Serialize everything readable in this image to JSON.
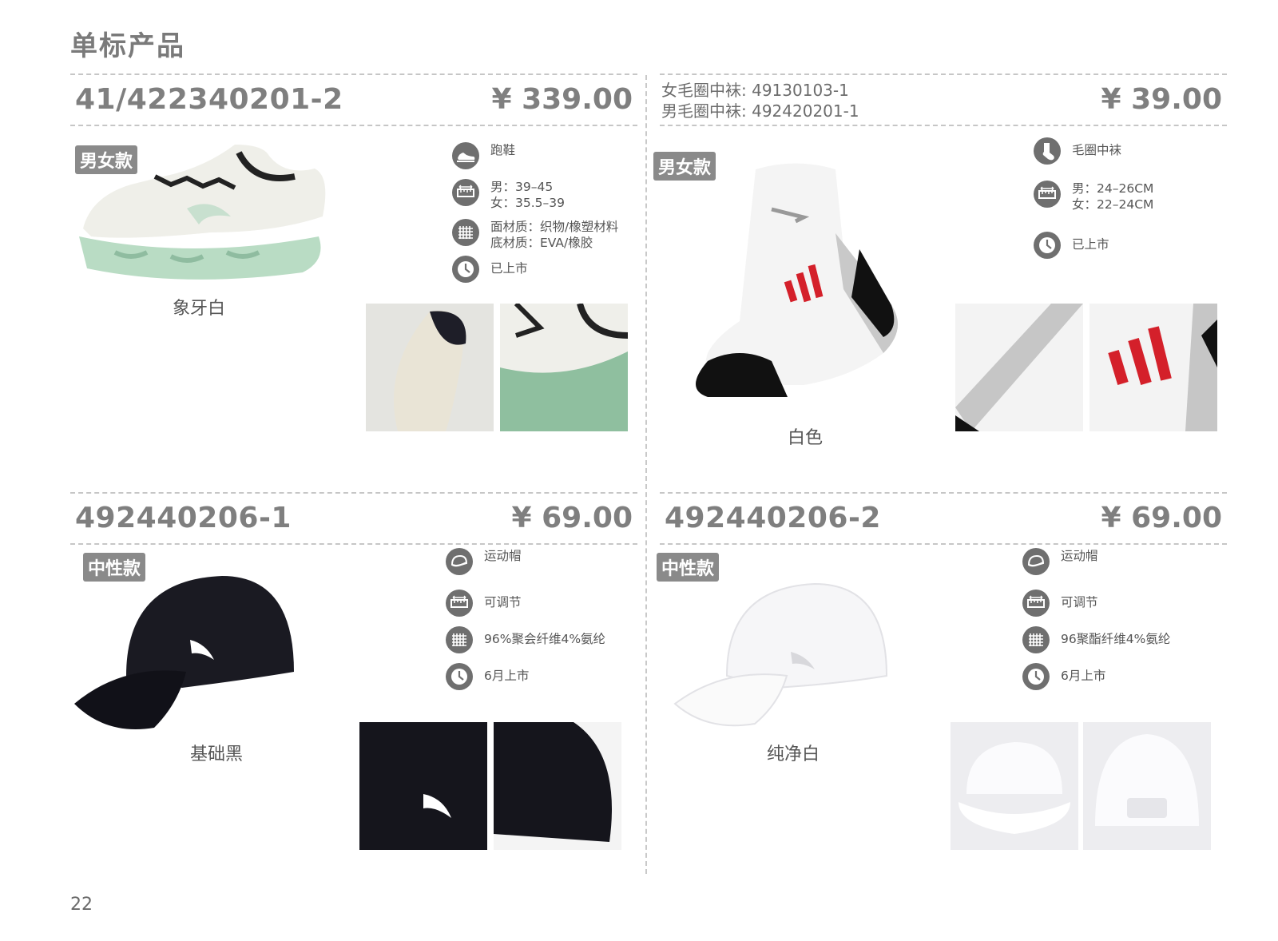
{
  "page": {
    "title": "单标产品",
    "number": "22"
  },
  "products": [
    {
      "sku": "41/422340201-2",
      "price": "¥ 339.00",
      "badge": "男女款",
      "color_name": "象牙白",
      "specs": [
        {
          "icon": "running-shoe-icon",
          "lines": [
            "跑鞋"
          ]
        },
        {
          "icon": "size-ruler-icon",
          "lines": [
            "男：39–45",
            "女：35.5–39"
          ]
        },
        {
          "icon": "fabric-material-icon",
          "lines": [
            "面材质：织物/橡塑材料",
            "底材质：EVA/橡胶"
          ]
        },
        {
          "icon": "clock-icon",
          "lines": [
            "已上市"
          ]
        }
      ]
    },
    {
      "sku_lines": [
        "女毛圈中袜: 49130103-1",
        "男毛圈中袜: 492420201-1"
      ],
      "price": "¥ 39.00",
      "badge": "男女款",
      "color_name": "白色",
      "specs": [
        {
          "icon": "sock-icon",
          "lines": [
            "毛圈中袜"
          ]
        },
        {
          "icon": "size-ruler-icon",
          "lines": [
            "男：24–26CM",
            "女：22–24CM"
          ]
        },
        {
          "icon": "clock-icon",
          "lines": [
            "已上市"
          ]
        }
      ]
    },
    {
      "sku": "492440206-1",
      "price": "¥ 69.00",
      "badge": "中性款",
      "color_name": "基础黑",
      "specs": [
        {
          "icon": "cap-icon",
          "lines": [
            "运动帽"
          ]
        },
        {
          "icon": "size-ruler-icon",
          "lines": [
            "可调节"
          ]
        },
        {
          "icon": "fabric-material-icon",
          "lines": [
            "96%聚会纤维4%氨纶"
          ]
        },
        {
          "icon": "clock-icon",
          "lines": [
            "6月上市"
          ]
        }
      ]
    },
    {
      "sku": "492440206-2",
      "price": "¥ 69.00",
      "badge": "中性款",
      "color_name": "纯净白",
      "specs": [
        {
          "icon": "cap-icon",
          "lines": [
            "运动帽"
          ]
        },
        {
          "icon": "size-ruler-icon",
          "lines": [
            "可调节"
          ]
        },
        {
          "icon": "fabric-material-icon",
          "lines": [
            "96聚酯纤维4%氨纶"
          ]
        },
        {
          "icon": "clock-icon",
          "lines": [
            "6月上市"
          ]
        }
      ]
    }
  ]
}
